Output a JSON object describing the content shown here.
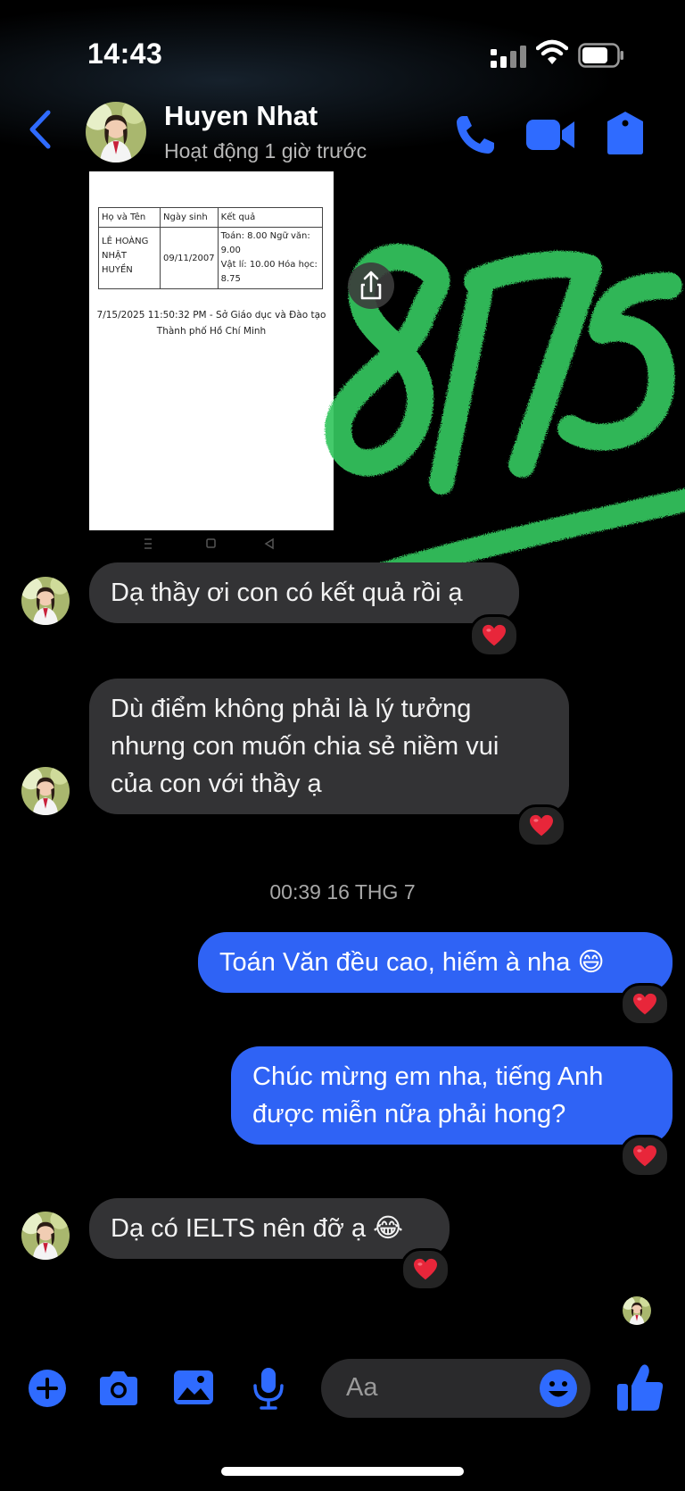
{
  "status_bar": {
    "time": "14:43"
  },
  "header": {
    "contact_name": "Huyen Nhat",
    "contact_status": "Hoạt động 1 giờ trước",
    "icons": [
      "back-chevron-icon",
      "phone-icon",
      "video-camera-icon",
      "shield-icon"
    ]
  },
  "attachment": {
    "table": {
      "headers": [
        "Họ và Tên",
        "Ngày sinh",
        "Kết quả"
      ],
      "row": {
        "name_line1": "LÊ HOÀNG",
        "name_line2": "NHẬT HUYỀN",
        "dob": "09/11/2007",
        "result_line1": "Toán: 8.00 Ngữ văn: 9.00",
        "result_line2": "Vật lí: 10.00 Hóa học:",
        "result_line3": "8.75"
      }
    },
    "caption_line1": "7/15/2025 11:50:32 PM - Sở Giáo dục và Đào tạo",
    "caption_line2": "Thành phố Hồ Chí Minh",
    "overlay_text": "8.75"
  },
  "messages": [
    {
      "from": "them",
      "text": "Dạ thầy ơi con có kết quả rồi ạ",
      "reaction": "❤️"
    },
    {
      "from": "them",
      "text": "Dù điểm không phải là lý tưởng nhưng con muốn chia sẻ niềm vui của con với thầy ạ",
      "reaction": "❤️"
    },
    {
      "from": "me",
      "text": "Toán Văn đều cao, hiếm à nha 😄",
      "reaction": "❤️"
    },
    {
      "from": "me",
      "text": "Chúc mừng em nha, tiếng Anh được miễn nữa phải hong?",
      "reaction": "❤️"
    },
    {
      "from": "them",
      "text": "Dạ có IELTS nên đỡ ạ 😂",
      "reaction": "❤️"
    }
  ],
  "timestamp": "00:39 16 THG 7",
  "composer": {
    "placeholder": "Aa",
    "icons": [
      "plus-icon",
      "camera-icon",
      "gallery-icon",
      "microphone-icon",
      "emoji-icon",
      "thumbs-up-icon"
    ]
  },
  "colors": {
    "accent": "#2f6bff",
    "outgoing": "#2f63f5",
    "incoming": "#333335",
    "heart": "#e8263a",
    "scribble": "#3fd26a"
  }
}
